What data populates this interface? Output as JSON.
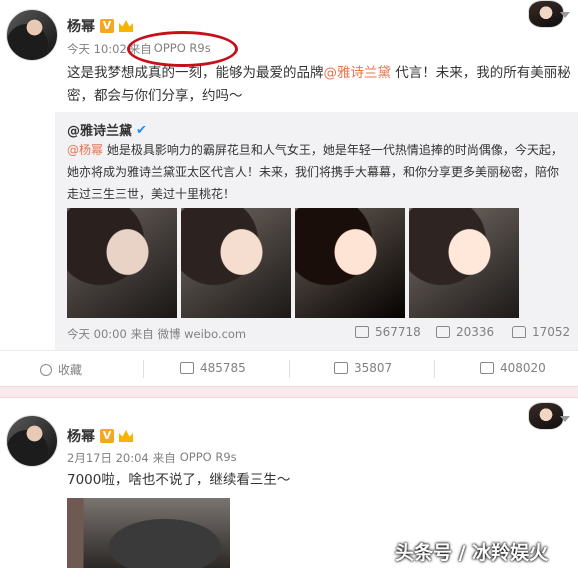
{
  "post1": {
    "author": "杨幂",
    "verified_badge": "V",
    "time": "今天 10:02",
    "source_prefix": "来自",
    "source": "OPPO R9s",
    "text_before": "这是我梦想成真的一刻，能够为最爱的品牌",
    "mention": "@雅诗兰黛",
    "text_after": " 代言！未来，我的所有美丽秘密，都会与你们分享，约吗～",
    "quote": {
      "author": "@雅诗兰黛",
      "mention": "@杨幂",
      "text": " 她是极具影响力的霸屏花旦和人气女王，她是年轻一代热情追捧的时尚偶像，今天起，她亦将成为雅诗兰黛亚太区代言人！未来，我们将携手大幕幕，和你分享更多美丽秘密，陪你走过三生三世，美过十里桃花！",
      "time": "今天 00:00",
      "source": "来自 微博 weibo.com",
      "reposts": "567718",
      "comments": "20336",
      "likes": "17052"
    },
    "actions": {
      "favorite": "收藏",
      "repost": "485785",
      "comment": "35807",
      "like": "408020"
    }
  },
  "post2": {
    "author": "杨幂",
    "verified_badge": "V",
    "time": "2月17日 20:04",
    "source_prefix": "来自",
    "source": "OPPO R9s",
    "text": "7000啦，啥也不说了，继续看三生～"
  },
  "watermark": "头条号 / 冰羚娱火",
  "colors": {
    "mention": "#eb7350",
    "highlight_circle": "#c6101a",
    "divider": "#f7e9ec"
  }
}
